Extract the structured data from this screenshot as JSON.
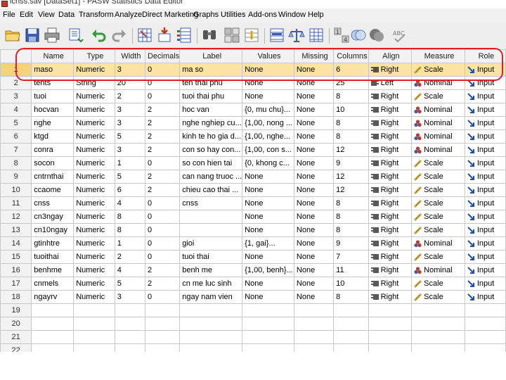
{
  "window": {
    "title": "lcnss.sav [DataSet1] - PASW Statistics Data Editor"
  },
  "menu": [
    "File",
    "Edit",
    "View",
    "Data",
    "Transform",
    "Analyze",
    "Direct Marketing",
    "Graphs",
    "Utilities",
    "Add-ons",
    "Window",
    "Help"
  ],
  "toolbar": {
    "icons": [
      "open-folder-icon",
      "save-icon",
      "print-icon",
      "dialog-recall-icon",
      "undo-icon",
      "redo-icon",
      "goto-case-icon",
      "goto-variable-icon",
      "variables-icon",
      "find-icon",
      "split-file-icon",
      "insert-cases-icon",
      "select-cases-icon",
      "value-labels-icon",
      "weight-cases-icon",
      "use-sets-icon",
      "show-all-icon",
      "venn-icon",
      "circles-icon",
      "spelling-icon"
    ],
    "spelling_label": "ABC"
  },
  "columns": [
    "Name",
    "Type",
    "Width",
    "Decimals",
    "Label",
    "Values",
    "Missing",
    "Columns",
    "Align",
    "Measure",
    "Role"
  ],
  "rows": [
    {
      "num": "1",
      "name": "maso",
      "type": "Numeric",
      "width": "3",
      "decimals": "0",
      "label": "ma so",
      "values": "None",
      "missing": "None",
      "columns": "6",
      "align": "Right",
      "measure": "Scale",
      "role": "Input"
    },
    {
      "num": "2",
      "name": "tents",
      "type": "String",
      "width": "20",
      "decimals": "0",
      "label": "ten thai phu",
      "values": "None",
      "missing": "None",
      "columns": "25",
      "align": "Left",
      "measure": "Nominal",
      "role": "Input"
    },
    {
      "num": "3",
      "name": "tuoi",
      "type": "Numeric",
      "width": "2",
      "decimals": "0",
      "label": "tuoi thai phu",
      "values": "None",
      "missing": "None",
      "columns": "8",
      "align": "Right",
      "measure": "Scale",
      "role": "Input"
    },
    {
      "num": "4",
      "name": "hocvan",
      "type": "Numeric",
      "width": "3",
      "decimals": "2",
      "label": "hoc van",
      "values": "{0, mu chu}...",
      "missing": "None",
      "columns": "10",
      "align": "Right",
      "measure": "Nominal",
      "role": "Input"
    },
    {
      "num": "5",
      "name": "nghe",
      "type": "Numeric",
      "width": "3",
      "decimals": "2",
      "label": "nghe nghiep cu...",
      "values": "{1,00, nong ...",
      "missing": "None",
      "columns": "8",
      "align": "Right",
      "measure": "Nominal",
      "role": "Input"
    },
    {
      "num": "6",
      "name": "ktgd",
      "type": "Numeric",
      "width": "5",
      "decimals": "2",
      "label": "kinh te ho gia d...",
      "values": "{1,00, nghe...",
      "missing": "None",
      "columns": "8",
      "align": "Right",
      "measure": "Nominal",
      "role": "Input"
    },
    {
      "num": "7",
      "name": "conra",
      "type": "Numeric",
      "width": "3",
      "decimals": "2",
      "label": "con so hay con...",
      "values": "{1,00, con s...",
      "missing": "None",
      "columns": "12",
      "align": "Right",
      "measure": "Nominal",
      "role": "Input"
    },
    {
      "num": "8",
      "name": "socon",
      "type": "Numeric",
      "width": "1",
      "decimals": "0",
      "label": "so con hien tai",
      "values": "{0, khong c...",
      "missing": "None",
      "columns": "9",
      "align": "Right",
      "measure": "Scale",
      "role": "Input"
    },
    {
      "num": "9",
      "name": "cntrnthai",
      "type": "Numeric",
      "width": "5",
      "decimals": "2",
      "label": "can nang truoc ...",
      "values": "None",
      "missing": "None",
      "columns": "12",
      "align": "Right",
      "measure": "Scale",
      "role": "Input"
    },
    {
      "num": "10",
      "name": "ccaome",
      "type": "Numeric",
      "width": "6",
      "decimals": "2",
      "label": "chieu cao thai ...",
      "values": "None",
      "missing": "None",
      "columns": "12",
      "align": "Right",
      "measure": "Scale",
      "role": "Input"
    },
    {
      "num": "11",
      "name": "cnss",
      "type": "Numeric",
      "width": "4",
      "decimals": "0",
      "label": "cnss",
      "values": "None",
      "missing": "None",
      "columns": "8",
      "align": "Right",
      "measure": "Scale",
      "role": "Input"
    },
    {
      "num": "12",
      "name": "cn3ngay",
      "type": "Numeric",
      "width": "8",
      "decimals": "0",
      "label": "",
      "values": "None",
      "missing": "None",
      "columns": "8",
      "align": "Right",
      "measure": "Scale",
      "role": "Input"
    },
    {
      "num": "13",
      "name": "cn10ngay",
      "type": "Numeric",
      "width": "8",
      "decimals": "0",
      "label": "",
      "values": "None",
      "missing": "None",
      "columns": "8",
      "align": "Right",
      "measure": "Scale",
      "role": "Input"
    },
    {
      "num": "14",
      "name": "gtinhtre",
      "type": "Numeric",
      "width": "1",
      "decimals": "0",
      "label": "gioi",
      "values": "{1, gai}...",
      "missing": "None",
      "columns": "9",
      "align": "Right",
      "measure": "Nominal",
      "role": "Input"
    },
    {
      "num": "15",
      "name": "tuoithai",
      "type": "Numeric",
      "width": "2",
      "decimals": "0",
      "label": "tuoi thai",
      "values": "None",
      "missing": "None",
      "columns": "7",
      "align": "Right",
      "measure": "Scale",
      "role": "Input"
    },
    {
      "num": "16",
      "name": "benhme",
      "type": "Numeric",
      "width": "4",
      "decimals": "2",
      "label": "benh me",
      "values": "{1,00, benh}...",
      "missing": "None",
      "columns": "11",
      "align": "Right",
      "measure": "Nominal",
      "role": "Input"
    },
    {
      "num": "17",
      "name": "cnmels",
      "type": "Numeric",
      "width": "5",
      "decimals": "2",
      "label": "cn me luc sinh",
      "values": "None",
      "missing": "None",
      "columns": "10",
      "align": "Right",
      "measure": "Scale",
      "role": "Input"
    },
    {
      "num": "18",
      "name": "ngayrv",
      "type": "Numeric",
      "width": "3",
      "decimals": "0",
      "label": "ngay nam vien",
      "values": "None",
      "missing": "None",
      "columns": "8",
      "align": "Right",
      "measure": "Scale",
      "role": "Input"
    }
  ],
  "empty_rows": [
    "19",
    "20",
    "21",
    "22"
  ],
  "colors": {
    "selection": "#fbe3a3",
    "highlight": "#e0202e",
    "header": "#f2f2f2"
  }
}
